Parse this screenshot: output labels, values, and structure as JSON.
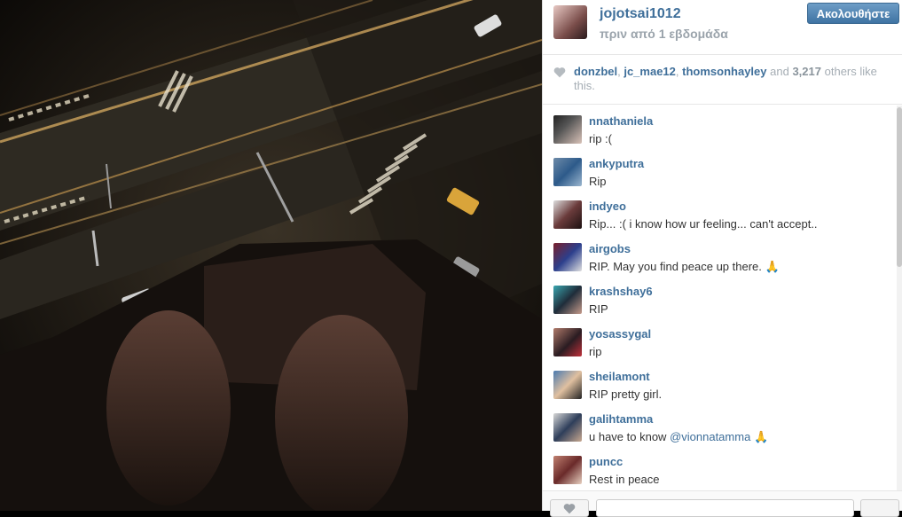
{
  "post": {
    "username": "jojotsai1012",
    "posted": "πριν από 1 εβδομάδα",
    "follow_label": "Ακολουθήστε"
  },
  "likes": {
    "users": [
      "donzbel",
      "jc_mae12",
      "thomsonhayley"
    ],
    "and_word": "and",
    "count": "3,217",
    "suffix": "others like this."
  },
  "comments": [
    {
      "user": "nnathaniela",
      "text": "rip :("
    },
    {
      "user": "ankyputra",
      "text": "Rip"
    },
    {
      "user": "indyeo",
      "text": "Rip... :( i know how ur feeling... can't accept.."
    },
    {
      "user": "airgobs",
      "text": "RIP. May you find peace up there. 🙏"
    },
    {
      "user": "krashshay6",
      "text": "RIP"
    },
    {
      "user": "yosassygal",
      "text": "rip"
    },
    {
      "user": "sheilamont",
      "text": "RIP pretty girl."
    },
    {
      "user": "galihtamma",
      "text": "u have to know ",
      "mention": "@vionnatamma",
      "emoji": "🙏"
    },
    {
      "user": "puncc",
      "text": "Rest in peace"
    }
  ],
  "icons": {
    "heart": "heart-icon"
  },
  "colors": {
    "link": "#3f6f9a",
    "follow_button": "#3f73a3"
  }
}
